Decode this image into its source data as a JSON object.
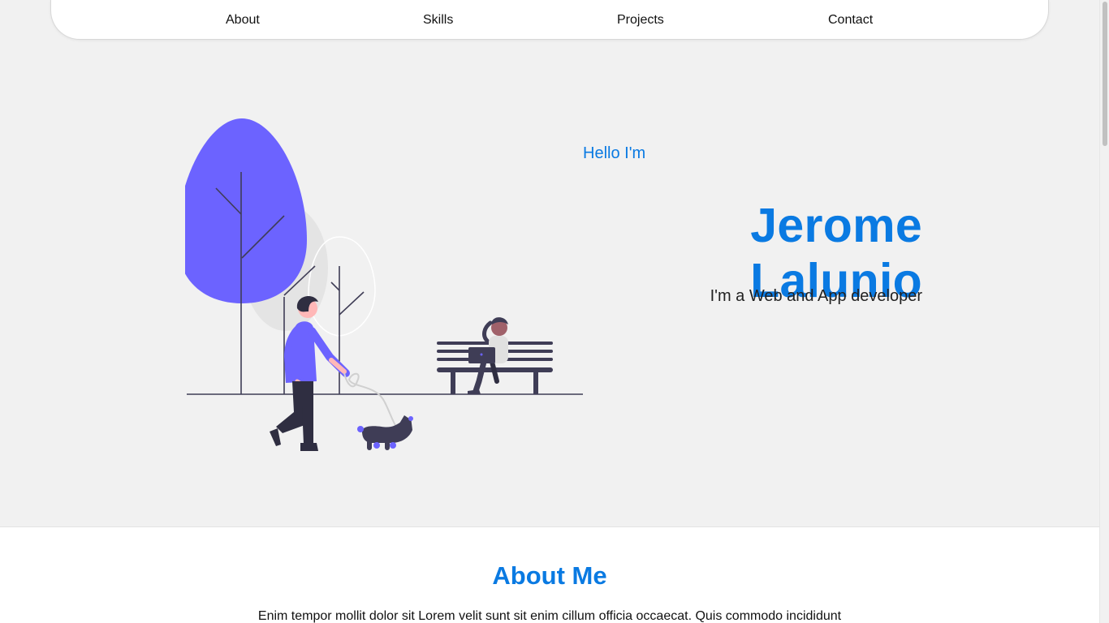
{
  "nav": {
    "links": [
      {
        "label": "About"
      },
      {
        "label": "Skills"
      },
      {
        "label": "Projects"
      },
      {
        "label": "Contact"
      }
    ]
  },
  "hero": {
    "greeting": "Hello I'm",
    "name": "Jerome Lalunio",
    "tagline": "I'm a Web and App developer"
  },
  "about": {
    "title": "About Me",
    "text": "Enim tempor mollit dolor sit Lorem velit sunt sit enim cillum officia occaecat. Quis commodo incididunt"
  },
  "colors": {
    "accent": "#0a7ae2",
    "illustration_primary": "#6c63ff",
    "illustration_dark": "#3f3d56",
    "background": "#f1f1f1"
  }
}
